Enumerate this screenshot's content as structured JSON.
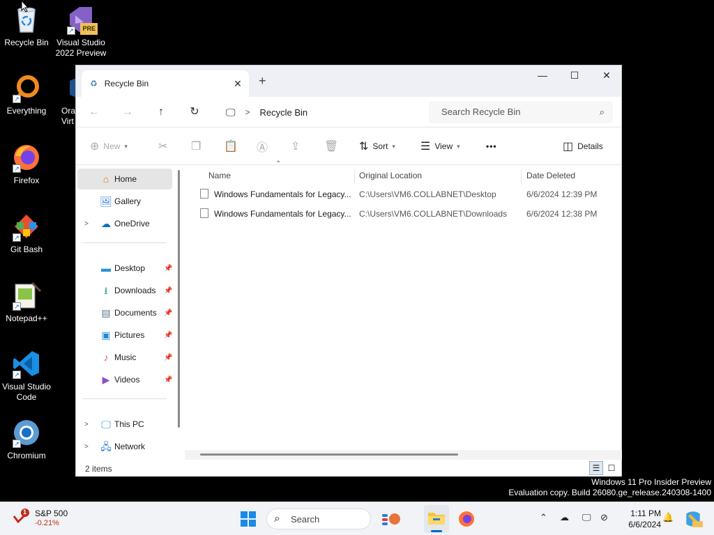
{
  "desktop": {
    "icons": [
      {
        "label": "Recycle Bin",
        "icon": "recycle-bin-icon"
      },
      {
        "label": "Visual Studio 2022 Preview",
        "icon": "visual-studio-icon",
        "badge": "PRE"
      },
      {
        "label": "Everything",
        "icon": "everything-icon"
      },
      {
        "label": "Ora Virt",
        "icon": "virtualbox-icon"
      },
      {
        "label": "Firefox",
        "icon": "firefox-icon"
      },
      {
        "label": "Git Bash",
        "icon": "git-bash-icon"
      },
      {
        "label": "Notepad++",
        "icon": "notepadpp-icon"
      },
      {
        "label": "Visual Studio Code",
        "icon": "vscode-icon"
      },
      {
        "label": "Chromium",
        "icon": "chromium-icon"
      }
    ]
  },
  "window": {
    "tab_title": "Recycle Bin",
    "new_tab": "+",
    "breadcrumb": "Recycle Bin",
    "search_placeholder": "Search Recycle Bin",
    "toolbar": {
      "new": "New",
      "sort": "Sort",
      "view": "View",
      "more": "•••",
      "details": "Details"
    },
    "nav": {
      "home": "Home",
      "gallery": "Gallery",
      "onedrive": "OneDrive",
      "desktop": "Desktop",
      "downloads": "Downloads",
      "documents": "Documents",
      "pictures": "Pictures",
      "music": "Music",
      "videos": "Videos",
      "thispc": "This PC",
      "network": "Network"
    },
    "columns": {
      "name": "Name",
      "original_location": "Original Location",
      "date_deleted": "Date Deleted"
    },
    "files": [
      {
        "name": "Windows Fundamentals for Legacy...",
        "location": "C:\\Users\\VM6.COLLABNET\\Desktop",
        "date": "6/6/2024 12:39 PM"
      },
      {
        "name": "Windows Fundamentals for Legacy...",
        "location": "C:\\Users\\VM6.COLLABNET\\Downloads",
        "date": "6/6/2024 12:38 PM"
      }
    ],
    "status": "2 items"
  },
  "watermark": {
    "line1": "Windows 11 Pro Insider Preview",
    "line2": "Evaluation copy. Build 26080.ge_release.240308-1400"
  },
  "taskbar": {
    "stock_name": "S&P 500",
    "stock_change": "-0.21%",
    "stock_alert": "1",
    "search_label": "Search",
    "time": "1:11 PM",
    "date": "6/6/2024"
  },
  "colors": {
    "accent": "#0067c0",
    "stock_negative": "#c42b1c",
    "desktop_bg": "#000000"
  }
}
